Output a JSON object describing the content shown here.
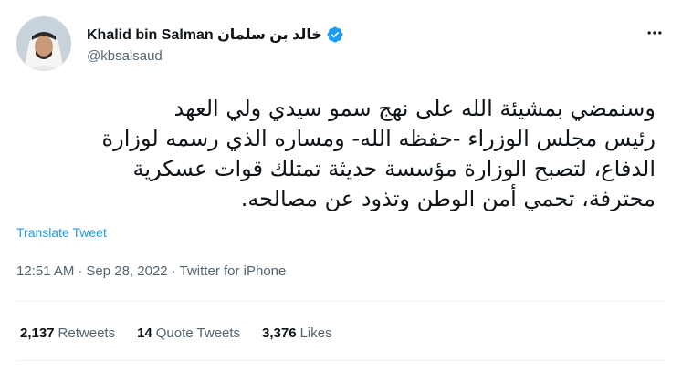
{
  "author": {
    "name": "Khalid bin Salman خالد بن سلمان",
    "handle": "@kbsalsaud",
    "verified": true,
    "avatar_icon": "profile-photo"
  },
  "tweet": {
    "text": "وسنمضي بمشيئة الله على نهج سمو سيدي ولي العهد\nرئيس مجلس الوزراء -حفظه الله- ومساره الذي رسمه لوزارة\nالدفاع، لتصبح الوزارة مؤسسة حديثة تمتلك قوات عسكرية\nمحترفة، تحمي أمن الوطن وتذود عن مصالحه.",
    "translate_label": "Translate Tweet",
    "time": "12:51 AM",
    "date": "Sep 28, 2022",
    "source": "Twitter for iPhone",
    "separator": "·"
  },
  "stats": {
    "retweets": {
      "count": "2,137",
      "label": "Retweets"
    },
    "quotes": {
      "count": "14",
      "label": "Quote Tweets"
    },
    "likes": {
      "count": "3,376",
      "label": "Likes"
    }
  },
  "colors": {
    "accent": "#1d9bf0",
    "secondary_text": "#536471",
    "primary_text": "#0f1419"
  },
  "icons": {
    "verified": "verified-badge-icon",
    "more": "more-options-icon"
  }
}
